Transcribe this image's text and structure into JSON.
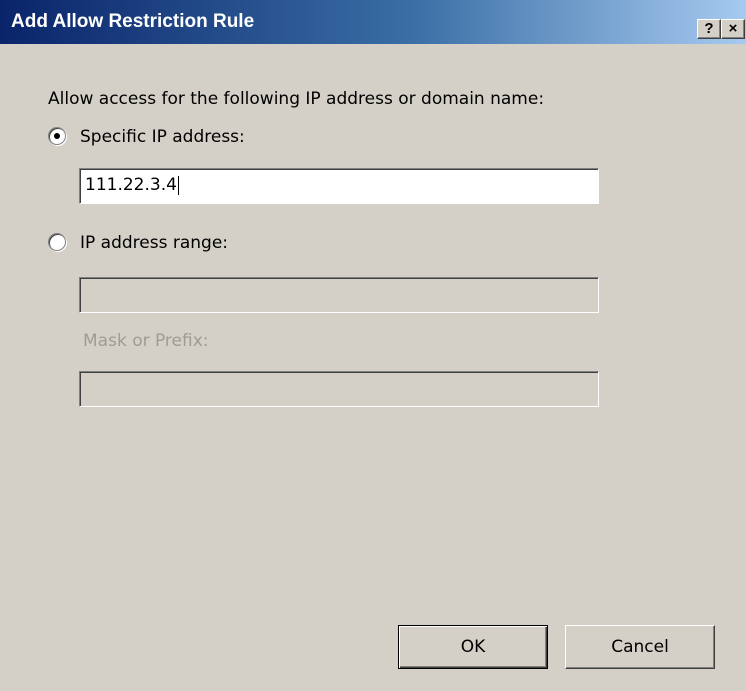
{
  "window": {
    "title": "Add Allow Restriction Rule",
    "help_label": "?",
    "close_label": "×"
  },
  "form": {
    "instruction": "Allow access for the following IP address or domain name:",
    "option_specific": {
      "label": "Specific IP address:",
      "selected": true,
      "value": "111.22.3.4"
    },
    "option_range": {
      "label": "IP address range:",
      "selected": false,
      "value": ""
    },
    "mask": {
      "label": "Mask or Prefix:",
      "value": ""
    }
  },
  "buttons": {
    "ok_label": "OK",
    "cancel_label": "Cancel"
  },
  "colors": {
    "title_gradient_start": "#0a246a",
    "title_gradient_end": "#a6caf0",
    "dialog_face": "#d4d0c8",
    "disabled_text": "#a09c94"
  },
  "icons": {
    "help": "question-mark-icon",
    "close": "close-icon"
  }
}
